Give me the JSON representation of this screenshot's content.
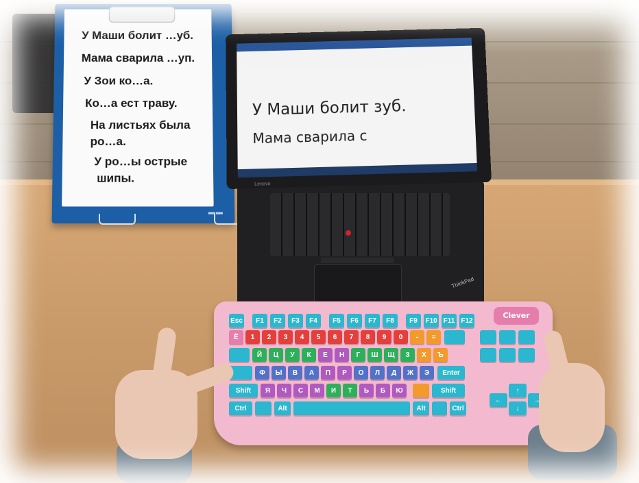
{
  "card": {
    "lines": [
      "У Маши болит …уб.",
      "Мама сварила …уп.",
      "У Зои ко…а.",
      "Ко…а ест траву.",
      "На листьях была",
      "ро…а.",
      "У ро…ы острые",
      "шипы."
    ]
  },
  "laptop": {
    "doc_lines": [
      "У Маши болит зуб.",
      "Мама сварила с"
    ],
    "brand_lid": "Lenovo",
    "brand_base": "ThinkPad"
  },
  "keyboard": {
    "logo": "Clever",
    "fn_keys": [
      "Esc",
      "F1",
      "F2",
      "F3",
      "F4",
      "F5",
      "F6",
      "F7",
      "F8",
      "F9",
      "F10",
      "F11",
      "F12"
    ],
    "number_row": [
      "Ё",
      "1",
      "2",
      "3",
      "4",
      "5",
      "6",
      "7",
      "8",
      "9",
      "0",
      "-",
      "="
    ],
    "row_q": [
      "Й",
      "Ц",
      "У",
      "К",
      "Е",
      "Н",
      "Г",
      "Ш",
      "Щ",
      "З",
      "Х",
      "Ъ"
    ],
    "row_a": [
      "Ф",
      "Ы",
      "В",
      "А",
      "П",
      "Р",
      "О",
      "Л",
      "Д",
      "Ж",
      "Э"
    ],
    "row_z": [
      "Я",
      "Ч",
      "С",
      "М",
      "И",
      "Т",
      "Ь",
      "Б",
      "Ю"
    ],
    "labels": {
      "shift": "Shift",
      "enter": "Enter",
      "ctrl": "Ctrl",
      "alt": "Alt"
    }
  },
  "colors": {
    "keyboard_body": "#f2b9cf",
    "stand": "#1c5fa6",
    "key_red": "#e53f3c",
    "key_green": "#2cb15a",
    "key_blue": "#5272c9",
    "key_purple": "#b05ac0",
    "key_orange": "#f29a2c",
    "key_fn": "#2ab7cf"
  }
}
